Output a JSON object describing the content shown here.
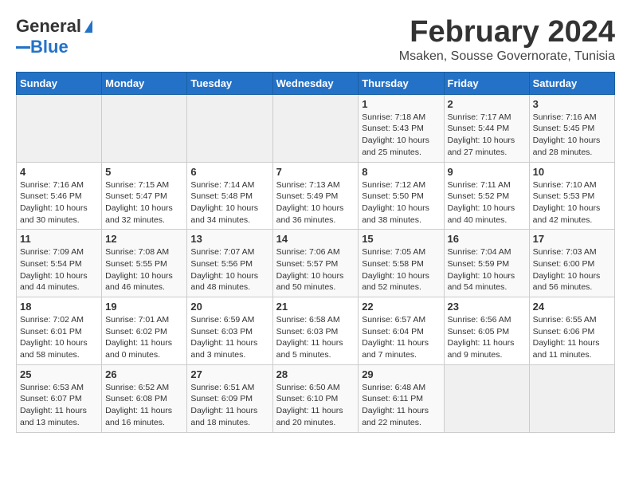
{
  "header": {
    "logo_general": "General",
    "logo_blue": "Blue",
    "title": "February 2024",
    "subtitle": "Msaken, Sousse Governorate, Tunisia"
  },
  "calendar": {
    "days_of_week": [
      "Sunday",
      "Monday",
      "Tuesday",
      "Wednesday",
      "Thursday",
      "Friday",
      "Saturday"
    ],
    "weeks": [
      [
        {
          "day": "",
          "info": ""
        },
        {
          "day": "",
          "info": ""
        },
        {
          "day": "",
          "info": ""
        },
        {
          "day": "",
          "info": ""
        },
        {
          "day": "1",
          "info": "Sunrise: 7:18 AM\nSunset: 5:43 PM\nDaylight: 10 hours and 25 minutes."
        },
        {
          "day": "2",
          "info": "Sunrise: 7:17 AM\nSunset: 5:44 PM\nDaylight: 10 hours and 27 minutes."
        },
        {
          "day": "3",
          "info": "Sunrise: 7:16 AM\nSunset: 5:45 PM\nDaylight: 10 hours and 28 minutes."
        }
      ],
      [
        {
          "day": "4",
          "info": "Sunrise: 7:16 AM\nSunset: 5:46 PM\nDaylight: 10 hours and 30 minutes."
        },
        {
          "day": "5",
          "info": "Sunrise: 7:15 AM\nSunset: 5:47 PM\nDaylight: 10 hours and 32 minutes."
        },
        {
          "day": "6",
          "info": "Sunrise: 7:14 AM\nSunset: 5:48 PM\nDaylight: 10 hours and 34 minutes."
        },
        {
          "day": "7",
          "info": "Sunrise: 7:13 AM\nSunset: 5:49 PM\nDaylight: 10 hours and 36 minutes."
        },
        {
          "day": "8",
          "info": "Sunrise: 7:12 AM\nSunset: 5:50 PM\nDaylight: 10 hours and 38 minutes."
        },
        {
          "day": "9",
          "info": "Sunrise: 7:11 AM\nSunset: 5:52 PM\nDaylight: 10 hours and 40 minutes."
        },
        {
          "day": "10",
          "info": "Sunrise: 7:10 AM\nSunset: 5:53 PM\nDaylight: 10 hours and 42 minutes."
        }
      ],
      [
        {
          "day": "11",
          "info": "Sunrise: 7:09 AM\nSunset: 5:54 PM\nDaylight: 10 hours and 44 minutes."
        },
        {
          "day": "12",
          "info": "Sunrise: 7:08 AM\nSunset: 5:55 PM\nDaylight: 10 hours and 46 minutes."
        },
        {
          "day": "13",
          "info": "Sunrise: 7:07 AM\nSunset: 5:56 PM\nDaylight: 10 hours and 48 minutes."
        },
        {
          "day": "14",
          "info": "Sunrise: 7:06 AM\nSunset: 5:57 PM\nDaylight: 10 hours and 50 minutes."
        },
        {
          "day": "15",
          "info": "Sunrise: 7:05 AM\nSunset: 5:58 PM\nDaylight: 10 hours and 52 minutes."
        },
        {
          "day": "16",
          "info": "Sunrise: 7:04 AM\nSunset: 5:59 PM\nDaylight: 10 hours and 54 minutes."
        },
        {
          "day": "17",
          "info": "Sunrise: 7:03 AM\nSunset: 6:00 PM\nDaylight: 10 hours and 56 minutes."
        }
      ],
      [
        {
          "day": "18",
          "info": "Sunrise: 7:02 AM\nSunset: 6:01 PM\nDaylight: 10 hours and 58 minutes."
        },
        {
          "day": "19",
          "info": "Sunrise: 7:01 AM\nSunset: 6:02 PM\nDaylight: 11 hours and 0 minutes."
        },
        {
          "day": "20",
          "info": "Sunrise: 6:59 AM\nSunset: 6:03 PM\nDaylight: 11 hours and 3 minutes."
        },
        {
          "day": "21",
          "info": "Sunrise: 6:58 AM\nSunset: 6:03 PM\nDaylight: 11 hours and 5 minutes."
        },
        {
          "day": "22",
          "info": "Sunrise: 6:57 AM\nSunset: 6:04 PM\nDaylight: 11 hours and 7 minutes."
        },
        {
          "day": "23",
          "info": "Sunrise: 6:56 AM\nSunset: 6:05 PM\nDaylight: 11 hours and 9 minutes."
        },
        {
          "day": "24",
          "info": "Sunrise: 6:55 AM\nSunset: 6:06 PM\nDaylight: 11 hours and 11 minutes."
        }
      ],
      [
        {
          "day": "25",
          "info": "Sunrise: 6:53 AM\nSunset: 6:07 PM\nDaylight: 11 hours and 13 minutes."
        },
        {
          "day": "26",
          "info": "Sunrise: 6:52 AM\nSunset: 6:08 PM\nDaylight: 11 hours and 16 minutes."
        },
        {
          "day": "27",
          "info": "Sunrise: 6:51 AM\nSunset: 6:09 PM\nDaylight: 11 hours and 18 minutes."
        },
        {
          "day": "28",
          "info": "Sunrise: 6:50 AM\nSunset: 6:10 PM\nDaylight: 11 hours and 20 minutes."
        },
        {
          "day": "29",
          "info": "Sunrise: 6:48 AM\nSunset: 6:11 PM\nDaylight: 11 hours and 22 minutes."
        },
        {
          "day": "",
          "info": ""
        },
        {
          "day": "",
          "info": ""
        }
      ]
    ]
  }
}
